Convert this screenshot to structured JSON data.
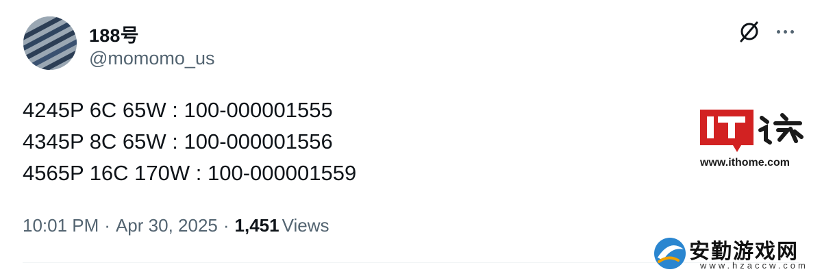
{
  "user": {
    "display_name": "188号",
    "handle": "@momomo_us"
  },
  "header_actions": {
    "grok_icon": "grok-slashed-circle-icon",
    "more_icon": "ellipsis-icon"
  },
  "tweet": {
    "lines": [
      "4245P 6C 65W : 100-000001555",
      "4345P 8C 65W : 100-000001556",
      "4565P 16C 170W : 100-000001559"
    ]
  },
  "meta": {
    "time": "10:01 PM",
    "separator": "·",
    "date": "Apr 30, 2025",
    "views_count": "1,451",
    "views_label": "Views"
  },
  "watermarks": {
    "ithome": {
      "logo": "IT之家",
      "site": "www.ithome.com",
      "brand_color": "#d22222"
    },
    "hzaccw": {
      "name": "安勤游戏网",
      "url": "www.hzaccw.com"
    }
  },
  "colors": {
    "text_primary": "#0f1419",
    "text_secondary": "#536471",
    "divider": "#eff3f4"
  }
}
